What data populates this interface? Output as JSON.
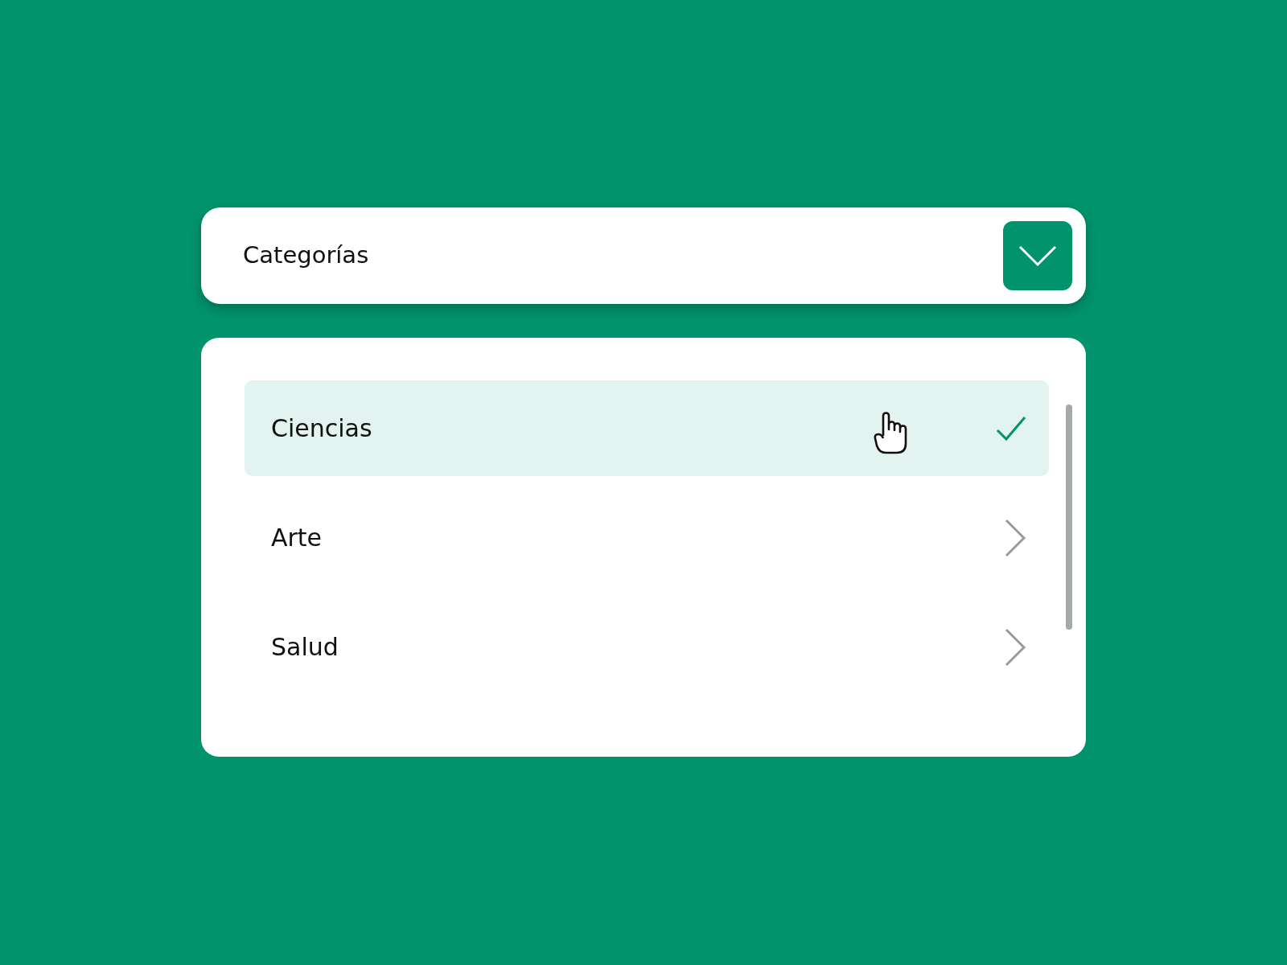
{
  "dropdown": {
    "label": "Categorías",
    "expanded": true
  },
  "options": [
    {
      "label": "Ciencias",
      "selected": true
    },
    {
      "label": "Arte",
      "selected": false
    },
    {
      "label": "Salud",
      "selected": false
    }
  ]
}
